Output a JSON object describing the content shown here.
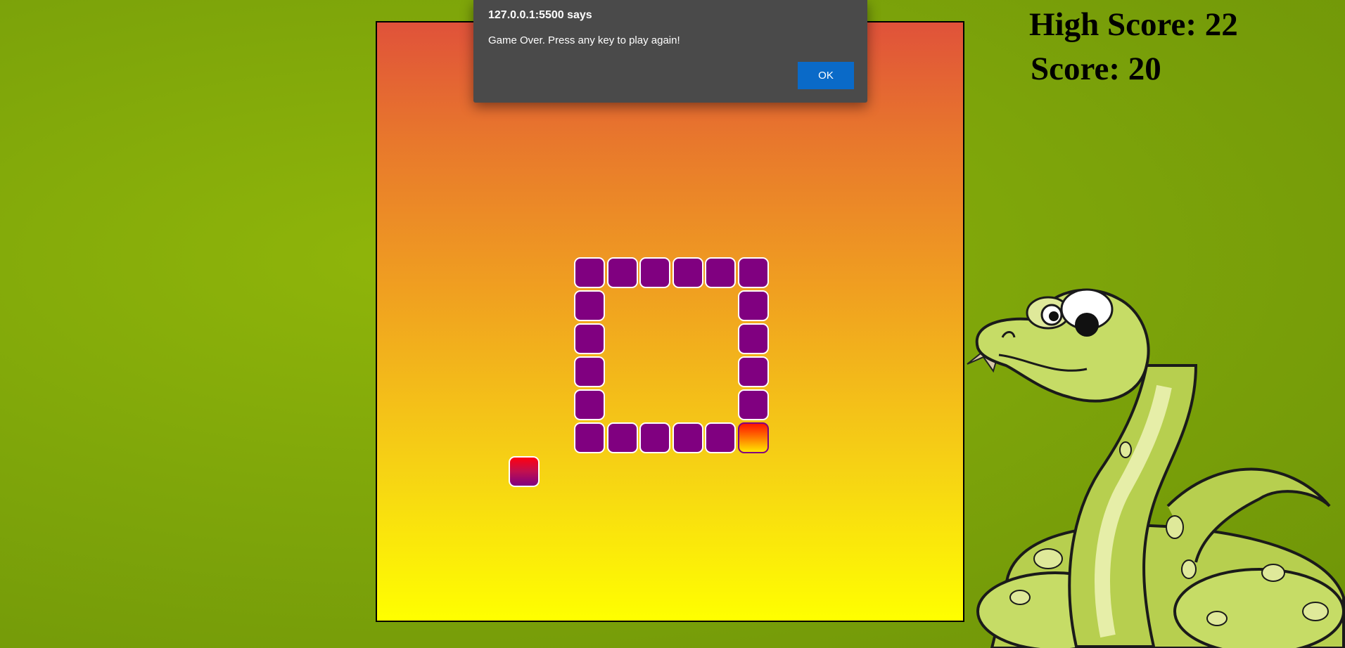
{
  "scoreboard": {
    "high_score": "High Score: 22",
    "score": "Score: 20"
  },
  "dialog": {
    "title": "127.0.0.1:5500 says",
    "message": "Game Over. Press any key to play again!",
    "ok_label": "OK"
  },
  "game": {
    "snake_color": "#800080",
    "food_color": "#c01050",
    "head_color": "#ff7a00",
    "mascot_icon": "cartoon-snake-icon"
  }
}
